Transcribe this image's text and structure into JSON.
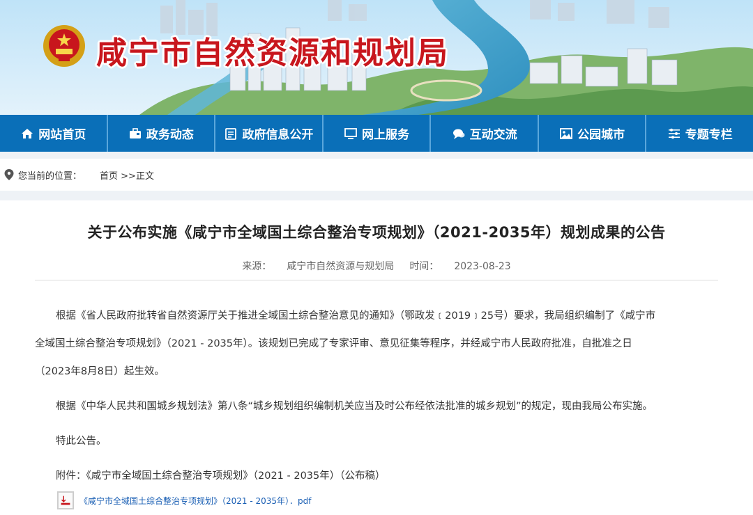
{
  "site": {
    "title": "咸宁市自然资源和规划局"
  },
  "nav": {
    "items": [
      {
        "label": "网站首页",
        "icon": "home-icon"
      },
      {
        "label": "政务动态",
        "icon": "briefcase-icon"
      },
      {
        "label": "政府信息公开",
        "icon": "document-icon"
      },
      {
        "label": "网上服务",
        "icon": "monitor-icon"
      },
      {
        "label": "互动交流",
        "icon": "chat-icon"
      },
      {
        "label": "公园城市",
        "icon": "picture-icon"
      },
      {
        "label": "专题专栏",
        "icon": "sliders-icon"
      }
    ]
  },
  "breadcrumb": {
    "label": "您当前的位置：",
    "home": "首页",
    "separator": " >>",
    "current": "正文"
  },
  "article": {
    "title": "关于公布实施《咸宁市全域国土综合整治专项规划》（2021-2035年）规划成果的公告",
    "source_label": "来源：",
    "source": "咸宁市自然资源与规划局",
    "time_label": "时间：",
    "time": "2023-08-23",
    "p1_line1": "根据《省人民政府批转省自然资源厅关于推进全域国土综合整治意见的通知》（鄂政发﹝2019﹞25号）要求，我局组织编制了《咸宁市",
    "p1_line2": "全域国土综合整治专项规划》（2021 - 2035年）。该规划已完成了专家评审、意见征集等程序，并经咸宁市人民政府批准，自批准之日",
    "p1_line3": "（2023年8月8日）起生效。",
    "p2": "根据《中华人民共和国城乡规划法》第八条“城乡规划组织编制机关应当及时公布经依法批准的城乡规划”的规定，现由我局公布实施。",
    "p3": "特此公告。",
    "p4": "附件：《咸宁市全域国土综合整治专项规划》（2021 - 2035年）（公布稿）",
    "attachment": "《咸宁市全域国土综合整治专项规划》（2021 - 2035年）．pdf"
  },
  "colors": {
    "nav_bg": "#0a6fb8",
    "title_red": "#c8161d",
    "link_blue": "#1a5fb4"
  }
}
